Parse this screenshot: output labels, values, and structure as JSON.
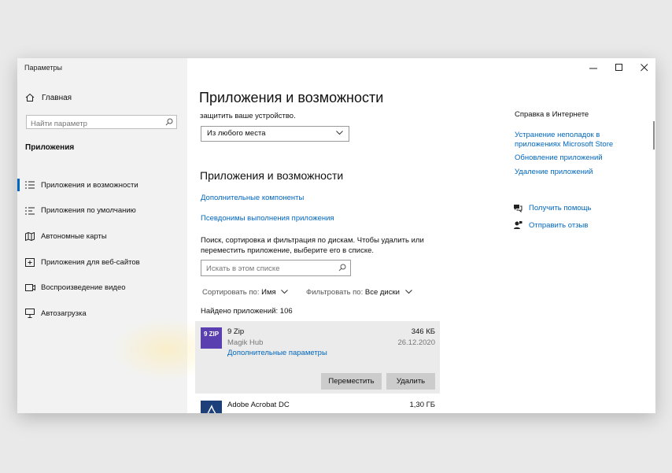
{
  "window": {
    "title": "Параметры"
  },
  "sidebar": {
    "home_label": "Главная",
    "search_placeholder": "Найти параметр",
    "section_title": "Приложения",
    "items": [
      {
        "label": "Приложения и возможности",
        "icon": "list-icon",
        "active": true
      },
      {
        "label": "Приложения по умолчанию",
        "icon": "list-default-icon"
      },
      {
        "label": "Автономные карты",
        "icon": "map-icon"
      },
      {
        "label": "Приложения для веб-сайтов",
        "icon": "web-app-icon"
      },
      {
        "label": "Воспроизведение видео",
        "icon": "video-icon"
      },
      {
        "label": "Автозагрузка",
        "icon": "startup-icon"
      }
    ]
  },
  "main": {
    "title": "Приложения и возможности",
    "clipped_text": "защитить ваше устройство.",
    "source_dropdown": "Из любого места",
    "section_title": "Приложения и возможности",
    "link_optional": "Дополнительные компоненты",
    "link_aliases": "Псевдонимы выполнения приложения",
    "description": "Поиск, сортировка и фильтрация по дискам. Чтобы удалить или переместить приложение, выберите его в списке.",
    "search_placeholder": "Искать в этом списке",
    "sort_label": "Сортировать по:",
    "sort_value": "Имя",
    "filter_label": "Фильтровать по:",
    "filter_value": "Все диски",
    "count_text": "Найдено приложений: 106",
    "apps": [
      {
        "name": "9 Zip",
        "publisher": "Magik Hub",
        "size": "346 КБ",
        "date": "26.12.2020",
        "advanced_link": "Дополнительные параметры",
        "icon_text": "9 ZIP",
        "icon_color": "#5a3fb0",
        "move_button": "Переместить",
        "uninstall_button": "Удалить"
      },
      {
        "name": "Adobe Acrobat DC",
        "size": "1,30 ГБ",
        "icon_color": "#1d3f7a"
      }
    ]
  },
  "help": {
    "title": "Справка в Интернете",
    "links": [
      "Устранение неполадок в приложениях Microsoft Store",
      "Обновление приложений",
      "Удаление приложений"
    ],
    "get_help": "Получить помощь",
    "feedback": "Отправить отзыв"
  },
  "colors": {
    "accent": "#0067c0",
    "sidebar_bg": "#f2f2f2"
  }
}
